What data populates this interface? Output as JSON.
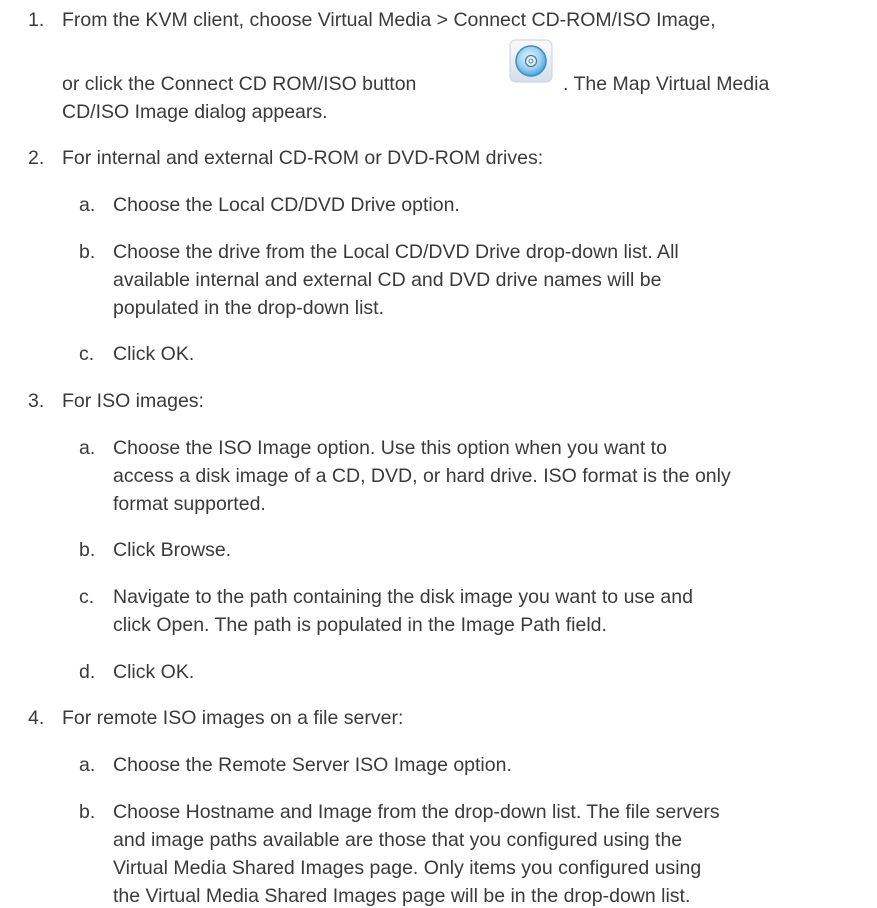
{
  "step1": {
    "num": "1.",
    "line1": "From the KVM client, choose Virtual Media > Connect CD-ROM/ISO Image,",
    "line2_pre": "or click the Connect CD ROM/ISO button",
    "line2_post": ". The Map Virtual Media",
    "line3": "CD/ISO Image dialog appears.",
    "icon": "cd-rom-icon"
  },
  "step2": {
    "num": "2.",
    "text": "For internal and external CD-ROM or DVD-ROM drives:",
    "a": {
      "letter": "a.",
      "lines": [
        "Choose the Local CD/DVD Drive option."
      ]
    },
    "b": {
      "letter": "b.",
      "lines": [
        "Choose the drive from the Local CD/DVD Drive drop-down list. All",
        "available internal and external CD and DVD drive names will be",
        "populated in the drop-down list."
      ]
    },
    "c": {
      "letter": "c.",
      "lines": [
        "Click OK."
      ]
    }
  },
  "step3": {
    "num": "3.",
    "text": "For ISO images:",
    "a": {
      "letter": "a.",
      "lines": [
        "Choose the ISO Image option. Use this option when you want to",
        "access a disk image of a CD, DVD, or hard drive. ISO format is the only",
        "format supported."
      ]
    },
    "b": {
      "letter": "b.",
      "lines": [
        "Click Browse."
      ]
    },
    "c": {
      "letter": "c.",
      "lines": [
        "Navigate to the path containing the disk image you want to use and",
        "click Open. The path is populated in the Image Path field."
      ]
    },
    "d": {
      "letter": "d.",
      "lines": [
        "Click OK."
      ]
    }
  },
  "step4": {
    "num": "4.",
    "text": "For remote ISO images on a file server:",
    "a": {
      "letter": "a.",
      "lines": [
        "Choose the Remote Server ISO Image option."
      ]
    },
    "b": {
      "letter": "b.",
      "lines": [
        "Choose Hostname and Image from the drop-down list. The file servers",
        "and image paths available are those that you configured using the",
        "Virtual Media Shared Images page. Only items you configured using",
        "the Virtual Media Shared Images page will be in the drop-down list."
      ]
    }
  }
}
